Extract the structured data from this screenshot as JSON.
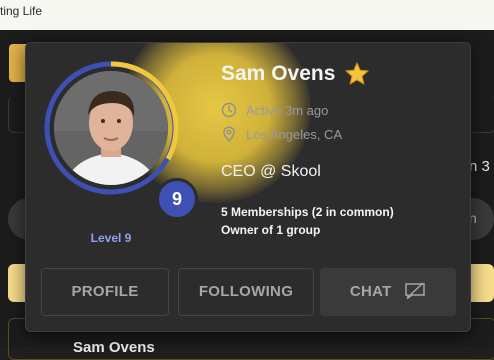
{
  "background": {
    "window_title": "ting Life",
    "side_text": "n 3",
    "oval_text": "n",
    "bottom_row_name": "Sam Ovens"
  },
  "profile_card": {
    "name": "Sam Ovens",
    "badge_icon": "star-icon",
    "active_status": "Active 3m ago",
    "location": "Los Angeles, CA",
    "role": "CEO @ Skool",
    "level_number": "9",
    "level_label": "Level 9",
    "memberships": "5 Memberships (2 in common)",
    "owner_of": "Owner of 1 group",
    "buttons": {
      "profile": "PROFILE",
      "following": "FOLLOWING",
      "chat": "CHAT"
    }
  },
  "colors": {
    "accent_yellow": "#f0c93a",
    "ring_blue": "#3e50b4",
    "level_text": "#8da2f2",
    "card_bg": "#2c2c2d"
  }
}
